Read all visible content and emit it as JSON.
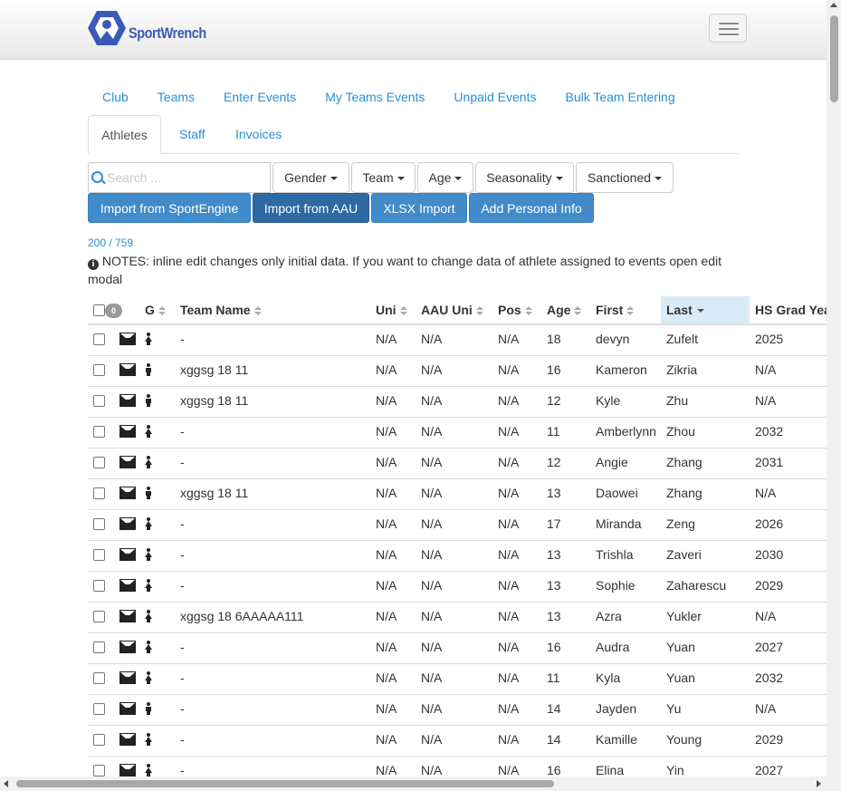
{
  "brand": {
    "name": "SportWrench",
    "color": "#3a59b8"
  },
  "nav_tabs": [
    "Club",
    "Teams",
    "Enter Events",
    "My Teams Events",
    "Unpaid Events",
    "Bulk Team Entering"
  ],
  "sub_tabs": {
    "active": "Athletes",
    "others": [
      "Staff",
      "Invoices"
    ]
  },
  "search": {
    "placeholder": "Search ..."
  },
  "filters": [
    "Gender",
    "Team",
    "Age",
    "Seasonality",
    "Sanctioned"
  ],
  "actions": [
    "Import from SportEngine",
    "Import from AAU",
    "XLSX Import",
    "Add Personal Info"
  ],
  "count_text": "200 / 759",
  "notes_text": "NOTES: inline edit changes only initial data. If you want to change data of athlete assigned to events open edit modal",
  "table": {
    "selected_badge": "0",
    "headers": {
      "g": "G",
      "team": "Team Name",
      "uni": "Uni",
      "aau_uni": "AAU Uni",
      "pos": "Pos",
      "age": "Age",
      "first": "First",
      "last": "Last",
      "grad": "HS Grad Year"
    },
    "sorted_column": "Last",
    "rows": [
      {
        "gender": "female",
        "team": "-",
        "uni": "N/A",
        "aau_uni": "N/A",
        "pos": "N/A",
        "age": "18",
        "first": "devyn",
        "last": "Zufelt",
        "grad": "2025"
      },
      {
        "gender": "male",
        "team": "xggsg 18 11",
        "uni": "N/A",
        "aau_uni": "N/A",
        "pos": "N/A",
        "age": "16",
        "first": "Kameron",
        "last": "Zikria",
        "grad": "N/A"
      },
      {
        "gender": "male",
        "team": "xggsg 18 11",
        "uni": "N/A",
        "aau_uni": "N/A",
        "pos": "N/A",
        "age": "12",
        "first": "Kyle",
        "last": "Zhu",
        "grad": "N/A"
      },
      {
        "gender": "female",
        "team": "-",
        "uni": "N/A",
        "aau_uni": "N/A",
        "pos": "N/A",
        "age": "11",
        "first": "Amberlynn",
        "last": "Zhou",
        "grad": "2032"
      },
      {
        "gender": "female",
        "team": "-",
        "uni": "N/A",
        "aau_uni": "N/A",
        "pos": "N/A",
        "age": "12",
        "first": "Angie",
        "last": "Zhang",
        "grad": "2031"
      },
      {
        "gender": "male",
        "team": "xggsg 18 11",
        "uni": "N/A",
        "aau_uni": "N/A",
        "pos": "N/A",
        "age": "13",
        "first": "Daowei",
        "last": "Zhang",
        "grad": "N/A"
      },
      {
        "gender": "female",
        "team": "-",
        "uni": "N/A",
        "aau_uni": "N/A",
        "pos": "N/A",
        "age": "17",
        "first": "Miranda",
        "last": "Zeng",
        "grad": "2026"
      },
      {
        "gender": "female",
        "team": "-",
        "uni": "N/A",
        "aau_uni": "N/A",
        "pos": "N/A",
        "age": "13",
        "first": "Trishla",
        "last": "Zaveri",
        "grad": "2030"
      },
      {
        "gender": "female",
        "team": "-",
        "uni": "N/A",
        "aau_uni": "N/A",
        "pos": "N/A",
        "age": "13",
        "first": "Sophie",
        "last": "Zaharescu",
        "grad": "2029"
      },
      {
        "gender": "female",
        "team": "xggsg 18 6AAAAA111",
        "uni": "N/A",
        "aau_uni": "N/A",
        "pos": "N/A",
        "age": "13",
        "first": "Azra",
        "last": "Yukler",
        "grad": "N/A"
      },
      {
        "gender": "female",
        "team": "-",
        "uni": "N/A",
        "aau_uni": "N/A",
        "pos": "N/A",
        "age": "16",
        "first": "Audra",
        "last": "Yuan",
        "grad": "2027"
      },
      {
        "gender": "female",
        "team": "-",
        "uni": "N/A",
        "aau_uni": "N/A",
        "pos": "N/A",
        "age": "11",
        "first": "Kyla",
        "last": "Yuan",
        "grad": "2032"
      },
      {
        "gender": "male",
        "team": "-",
        "uni": "N/A",
        "aau_uni": "N/A",
        "pos": "N/A",
        "age": "14",
        "first": "Jayden",
        "last": "Yu",
        "grad": "N/A"
      },
      {
        "gender": "female",
        "team": "-",
        "uni": "N/A",
        "aau_uni": "N/A",
        "pos": "N/A",
        "age": "14",
        "first": "Kamille",
        "last": "Young",
        "grad": "2029"
      },
      {
        "gender": "female",
        "team": "-",
        "uni": "N/A",
        "aau_uni": "N/A",
        "pos": "N/A",
        "age": "16",
        "first": "Elina",
        "last": "Yin",
        "grad": "2027"
      }
    ]
  }
}
